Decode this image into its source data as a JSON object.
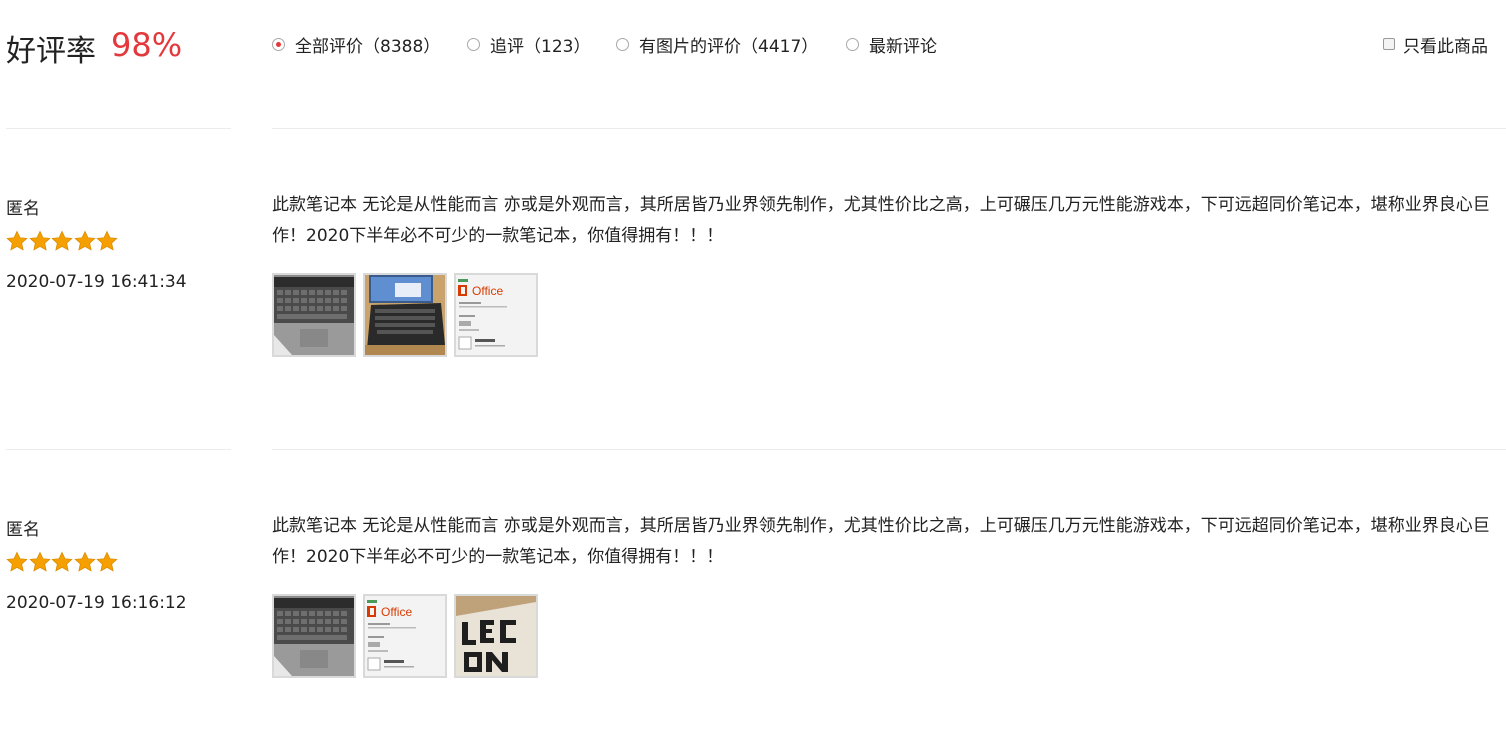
{
  "summary": {
    "title": "好评率",
    "rate": "98%",
    "rate_color": "#e4393c"
  },
  "filters": [
    {
      "label": "全部评价（8388）",
      "selected": true
    },
    {
      "label": "追评（123）",
      "selected": false
    },
    {
      "label": "有图片的评价（4417）",
      "selected": false
    },
    {
      "label": "最新评论",
      "selected": false
    }
  ],
  "only_this_product": {
    "label": "只看此商品",
    "checked": false
  },
  "reviews": [
    {
      "user": "匿名",
      "stars": 5,
      "time": "2020-07-19 16:41:34",
      "text": "此款笔记本 无论是从性能而言 亦或是外观而言，其所居皆乃业界领先制作，尤其性价比之高，上可碾压几万元性能游戏本，下可远超同价笔记本，堪称业界良心巨作！2020下半年必不可少的一款笔记本，你值得拥有！！！",
      "images": [
        {
          "icon": "laptop-keyboard-photo",
          "office": ""
        },
        {
          "icon": "laptop-screen-photo",
          "office": ""
        },
        {
          "icon": "office-card-photo",
          "office": "Office"
        }
      ]
    },
    {
      "user": "匿名",
      "stars": 5,
      "time": "2020-07-19 16:16:12",
      "text": "此款笔记本 无论是从性能而言 亦或是外观而言，其所居皆乃业界领先制作，尤其性价比之高，上可碾压几万元性能游戏本，下可远超同价笔记本，堪称业界良心巨作！2020下半年必不可少的一款笔记本，你值得拥有！！！",
      "images": [
        {
          "icon": "laptop-keyboard-photo",
          "office": ""
        },
        {
          "icon": "office-card-photo",
          "office": "Office"
        },
        {
          "icon": "legion-box-photo",
          "office": ""
        }
      ]
    }
  ],
  "colors": {
    "star": "#f5a000",
    "divider": "#ececec"
  }
}
